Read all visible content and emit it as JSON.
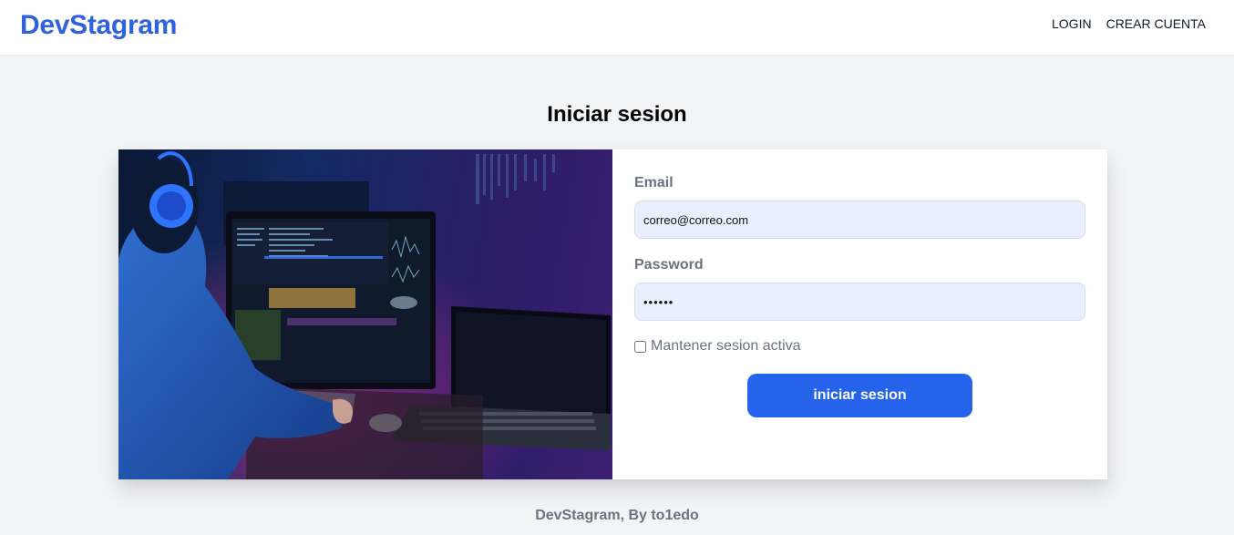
{
  "header": {
    "logo": "DevStagram",
    "nav": {
      "login": "LOGIN",
      "register": "CREAR CUENTA"
    }
  },
  "page": {
    "title": "Iniciar sesion"
  },
  "form": {
    "email_label": "Email",
    "email_value": "correo@correo.com",
    "password_label": "Password",
    "password_value": "••••••",
    "remember_label": "Mantener sesion activa",
    "remember_checked": false,
    "submit_label": "iniciar sesion"
  },
  "footer": {
    "text": "DevStagram, By to1edo"
  },
  "colors": {
    "brand": "#2f62db",
    "button": "#2563eb",
    "input_bg": "#e8f0fe",
    "page_bg": "#f3f4f6"
  }
}
